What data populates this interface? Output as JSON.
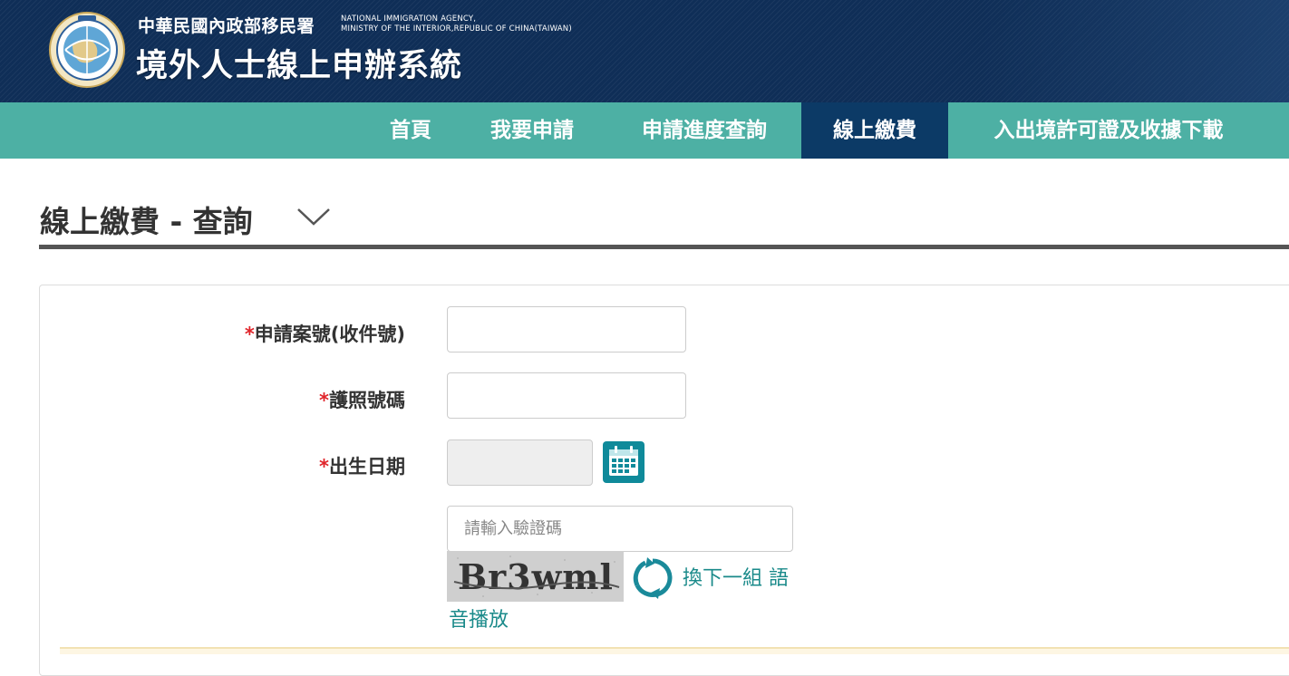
{
  "header": {
    "agency_cn": "中華民國內政部移民署",
    "agency_en_line1": "NATIONAL IMMIGRATION AGENCY,",
    "agency_en_line2": "MINISTRY OF THE INTERIOR,REPUBLIC OF CHINA(TAIWAN)",
    "system_title": "境外人士線上申辦系統",
    "logo_ring_text": "National Immigration Agency",
    "logo_top_text": "內政部移民署"
  },
  "nav": {
    "items": [
      {
        "label": "首頁",
        "active": false
      },
      {
        "label": "我要申請",
        "active": false
      },
      {
        "label": "申請進度查詢",
        "active": false
      },
      {
        "label": "線上繳費",
        "active": true
      },
      {
        "label": "入出境許可證及收據下載",
        "active": false
      }
    ]
  },
  "page": {
    "title": "線上繳費 - 查詢"
  },
  "form": {
    "required_mark": "*",
    "case_no_label": "申請案號(收件號)",
    "case_no_value": "",
    "passport_label": "護照號碼",
    "passport_value": "",
    "birth_label": "出生日期",
    "birth_value": "",
    "captcha_placeholder": "請輸入驗證碼",
    "captcha_text": "Br3wml",
    "refresh_label": "換下一組 語",
    "audio_label": "音播放"
  },
  "colors": {
    "header_bg": "#0f2e57",
    "nav_bg": "#4db0a4",
    "nav_active_bg": "#0c3a66",
    "required": "#e0242a",
    "link": "#1a8a8a",
    "icon_teal": "#0f8a9a"
  },
  "icons": {
    "calendar": "calendar-icon",
    "refresh": "refresh-icon",
    "chevron": "chevron-down-icon"
  }
}
